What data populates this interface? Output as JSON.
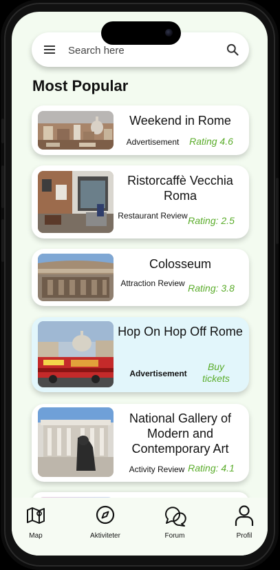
{
  "search": {
    "placeholder": "Search here"
  },
  "section_title": "Most Popular",
  "colors": {
    "background": "#f3fbf0",
    "rating_green": "#5aac2a",
    "ad_card": "#e2f6fb"
  },
  "cards": [
    {
      "title": "Weekend in Rome",
      "type": "Advertisement",
      "rating": "Rating 4.6"
    },
    {
      "title": "Ristorcaffè Vecchia Roma",
      "type": "Restaurant Review",
      "rating": "Rating: 2.5"
    },
    {
      "title": "Colosseum",
      "type": "Attraction Review",
      "rating": "Rating: 3.8"
    },
    {
      "title": "Hop On Hop Off Rome",
      "type": "Advertisement",
      "rating": "Buy tickets"
    },
    {
      "title": "National Gallery of Modern and Contemporary Art",
      "type": "Activity Review",
      "rating": "Rating: 4.1"
    }
  ],
  "nav": [
    {
      "label": "Map",
      "icon": "map-icon"
    },
    {
      "label": "Aktiviteter",
      "icon": "compass-icon"
    },
    {
      "label": "Forum",
      "icon": "chat-bubbles-icon"
    },
    {
      "label": "Profil",
      "icon": "user-icon"
    }
  ]
}
